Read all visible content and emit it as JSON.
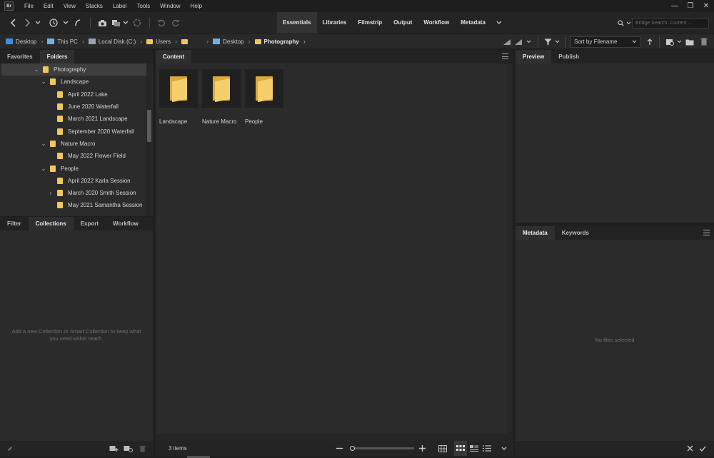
{
  "app": {
    "logo": "Br"
  },
  "menu": [
    "File",
    "Edit",
    "View",
    "Stacks",
    "Label",
    "Tools",
    "Window",
    "Help"
  ],
  "window_controls": {
    "minimize": "—",
    "restore": "❐",
    "close": "✕"
  },
  "workspaces": [
    "Essentials",
    "Libraries",
    "Filmstrip",
    "Output",
    "Workflow",
    "Metadata"
  ],
  "search": {
    "placeholder": "Bridge Search: Current ..."
  },
  "breadcrumb": [
    "Desktop",
    "This PC",
    "Local Disk (C:)",
    "Users",
    "",
    "Desktop",
    "Photography"
  ],
  "sort": {
    "label": "Sort by Filename"
  },
  "left_top_tabs": [
    "Favorites",
    "Folders"
  ],
  "folders_tree": [
    {
      "label": "Photography",
      "depth": 0,
      "expanded": true,
      "selected": true
    },
    {
      "label": "Landscape",
      "depth": 1,
      "expanded": true
    },
    {
      "label": "April 2022 Lake",
      "depth": 2
    },
    {
      "label": "June 2020 Waterfall",
      "depth": 2
    },
    {
      "label": "March 2021 Landscape",
      "depth": 2
    },
    {
      "label": "September 2020 Waterfall",
      "depth": 2
    },
    {
      "label": "Nature Macro",
      "depth": 1,
      "expanded": true
    },
    {
      "label": "May 2022 Flower Field",
      "depth": 2
    },
    {
      "label": "People",
      "depth": 1,
      "expanded": true
    },
    {
      "label": "April 2022 Karla Session",
      "depth": 2
    },
    {
      "label": "March 2020 Smith Session",
      "depth": 2,
      "collapsed": true
    },
    {
      "label": "May 2021 Samantha Session",
      "depth": 2
    }
  ],
  "left_bottom_tabs": [
    "Filter",
    "Collections",
    "Export",
    "Workflow"
  ],
  "collections_hint": "Add a new Collection or Smart Collection to keep what you need within reach.",
  "content": {
    "tab": "Content",
    "items": [
      "Landscape",
      "Nature Macro",
      "People"
    ],
    "count": "3 items"
  },
  "right_top_tabs": [
    "Preview",
    "Publish"
  ],
  "right_bottom_tabs": [
    "Metadata",
    "Keywords"
  ],
  "metadata_empty": "No files selected",
  "colors": {
    "folder": "#f0c75e",
    "panel": "#2b2b2b",
    "background": "#1f1f1f"
  }
}
